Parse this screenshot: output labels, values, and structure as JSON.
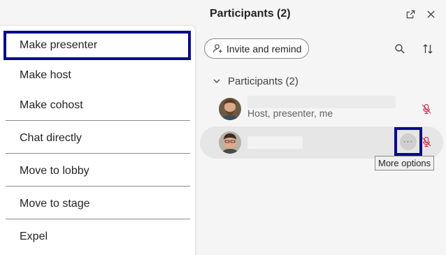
{
  "menu": {
    "items": [
      {
        "label": "Make presenter"
      },
      {
        "label": "Make host"
      },
      {
        "label": "Make cohost"
      },
      {
        "label": "Chat directly"
      },
      {
        "label": "Move to lobby"
      },
      {
        "label": "Move to stage"
      },
      {
        "label": "Expel"
      }
    ]
  },
  "panel": {
    "title": "Participants (2)",
    "header_icons": [
      "popout-icon",
      "close-icon"
    ],
    "invite_button_label": "Invite and remind",
    "toolbar_icons": [
      "search-icon",
      "sort-icon"
    ],
    "section_label": "Participants (2)",
    "participants": [
      {
        "role": "Host, presenter, me",
        "mic": "muted"
      },
      {
        "role": "",
        "mic": "muted"
      }
    ],
    "more_options_symbol": "···",
    "tooltip": "More options"
  },
  "colors": {
    "highlight_border": "#0a0a8c",
    "muted_mic": "#c4314b",
    "panel_bg": "#f5f5f5",
    "active_row_bg": "#e6e6e6"
  }
}
